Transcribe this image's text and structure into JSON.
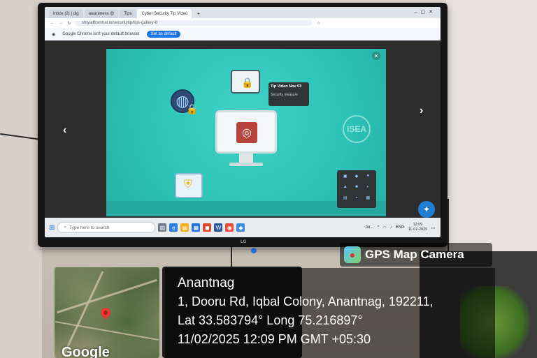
{
  "browser": {
    "tabs": [
      {
        "label": "Inbox (2) | dig"
      },
      {
        "label": "awareness @"
      },
      {
        "label": "Tips"
      },
      {
        "label": "Cyber Security Tip Video"
      }
    ],
    "url": "shiyadfcentral.io/securitytip/tips-gallery-8",
    "infobar_text": "Google Chrome isn't your default browser",
    "set_default_label": "Set as default"
  },
  "slide": {
    "tooltip_title": "Tip Video Nov 03",
    "tooltip_subtitle": "Security measure",
    "watermark": "ISEA"
  },
  "taskbar": {
    "search_placeholder": "Type here to search",
    "tray_label": "Air...",
    "lang": "ENG",
    "time": "12:09",
    "date": "11-02-2025"
  },
  "tv": {
    "brand": "LG"
  },
  "gps": {
    "app_title": "GPS Map Camera",
    "map_label": "Google",
    "city": "Anantnag",
    "address": "1, Dooru Rd, Iqbal Colony, Anantnag, 192211,",
    "coords": "Lat 33.583794° Long 75.216897°",
    "datetime": "11/02/2025 12:09 PM GMT +05:30"
  },
  "colors": {
    "slide_bg": "#2cc2b6",
    "accent_blue": "#1a73e8",
    "pin_red": "#e53935"
  },
  "icons": [
    "fingerprint-icon",
    "lock-icon",
    "globe-icon",
    "padlock-icon",
    "shield-icon",
    "windows-start-icon",
    "search-icon",
    "map-pin-icon",
    "gps-camera-logo-icon"
  ]
}
